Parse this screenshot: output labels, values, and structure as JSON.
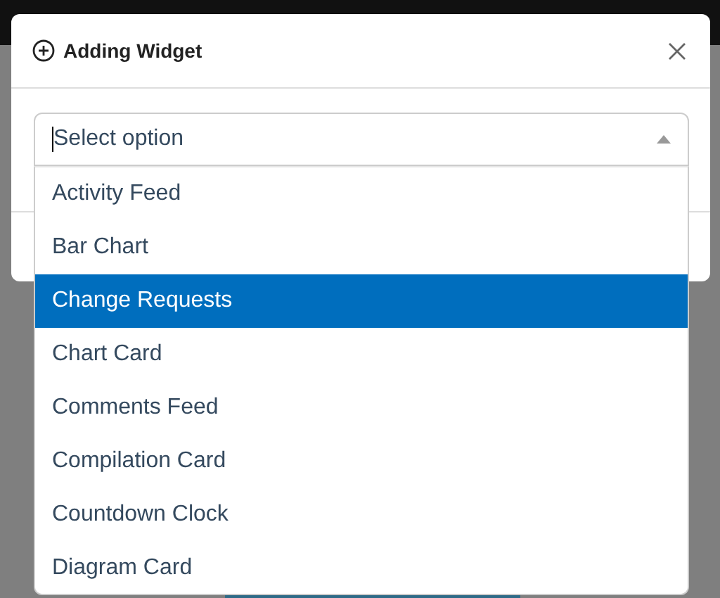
{
  "dialog": {
    "title": "Adding Widget"
  },
  "select": {
    "placeholder": "Select option",
    "expanded": true,
    "options": [
      {
        "label": "Activity Feed",
        "selected": false
      },
      {
        "label": "Bar Chart",
        "selected": false
      },
      {
        "label": "Change Requests",
        "selected": true
      },
      {
        "label": "Chart Card",
        "selected": false
      },
      {
        "label": "Comments Feed",
        "selected": false
      },
      {
        "label": "Compilation Card",
        "selected": false
      },
      {
        "label": "Countdown Clock",
        "selected": false
      },
      {
        "label": "Diagram Card",
        "selected": false
      }
    ]
  }
}
